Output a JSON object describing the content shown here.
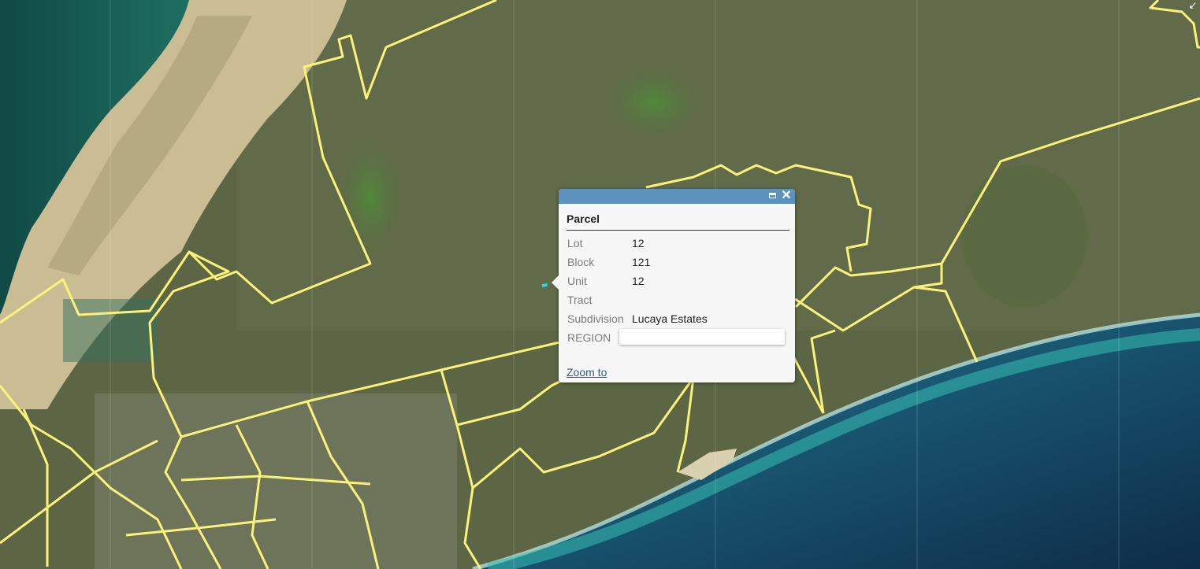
{
  "map": {
    "colors": {
      "parcel_outline": "#fbf27a",
      "land": "#5e6a45",
      "sand": "#cfc298",
      "ocean_deep": "#0f2f4f",
      "ocean_shallow": "#2bb3a8",
      "selected_parcel": "#35d4e8"
    },
    "corner_icon": "expand-arrow-icon"
  },
  "popup": {
    "header_color": "#5b93be",
    "maximize_icon": "maximize-icon",
    "close_icon": "close-icon",
    "title": "Parcel",
    "fields": [
      {
        "key": "Lot",
        "value": "12"
      },
      {
        "key": "Block",
        "value": "121"
      },
      {
        "key": "Unit",
        "value": "12"
      },
      {
        "key": "Tract",
        "value": ""
      },
      {
        "key": "Subdivision",
        "value": "Lucaya Estates"
      },
      {
        "key": "REGION",
        "value": ""
      }
    ],
    "zoom_label": "Zoom to"
  }
}
